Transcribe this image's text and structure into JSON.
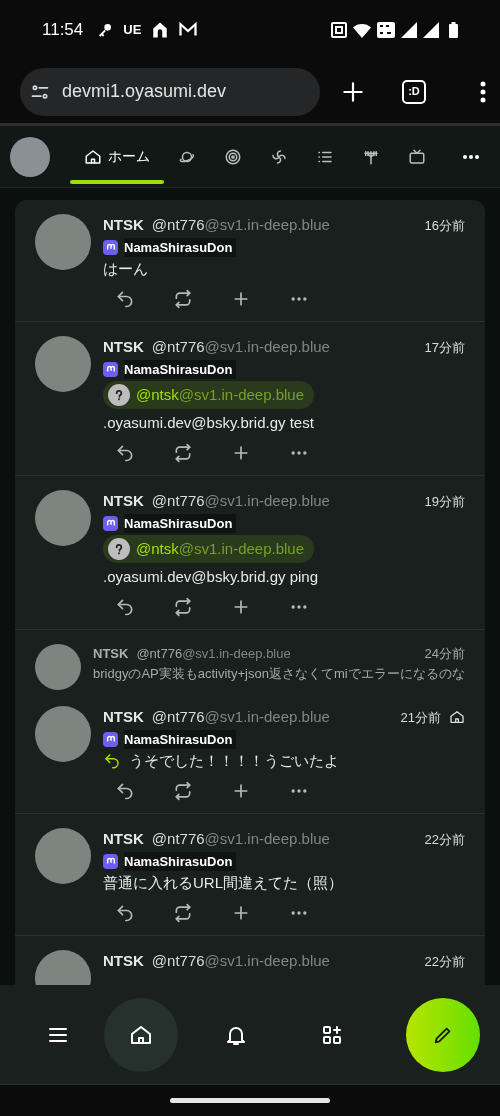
{
  "status_bar": {
    "time": "11:54",
    "carrier_mark": "UE"
  },
  "browser": {
    "url": "devmi1.oyasumi.dev",
    "tab_button": ":D"
  },
  "tabs": [
    {
      "kind": "home",
      "label": "ホーム",
      "selected": true
    },
    {
      "kind": "planet",
      "selected": false
    },
    {
      "kind": "spiral",
      "selected": false
    },
    {
      "kind": "swirl",
      "selected": false
    },
    {
      "kind": "list",
      "selected": false
    },
    {
      "kind": "antenna",
      "selected": false
    },
    {
      "kind": "tv",
      "selected": false
    }
  ],
  "posts": [
    {
      "kind": "note",
      "name": "NTSK",
      "user": "@nt776",
      "host": "@sv1.in-deep.blue",
      "time": "16分前",
      "instance": "NamaShirasuDon",
      "text": "はーん",
      "is_reply": false,
      "home_only": false
    },
    {
      "kind": "note",
      "name": "NTSK",
      "user": "@nt776",
      "host": "@sv1.in-deep.blue",
      "time": "17分前",
      "instance": "NamaShirasuDon",
      "mention": {
        "user": "@ntsk",
        "host": "@sv1.in-deep.blue"
      },
      "text": ".oyasumi.dev@bsky.brid.gy test",
      "is_reply": false,
      "home_only": false
    },
    {
      "kind": "note",
      "name": "NTSK",
      "user": "@nt776",
      "host": "@sv1.in-deep.blue",
      "time": "19分前",
      "instance": "NamaShirasuDon",
      "mention": {
        "user": "@ntsk",
        "host": "@sv1.in-deep.blue"
      },
      "text": ".oyasumi.dev@bsky.brid.gy ping",
      "is_reply": false,
      "home_only": false
    },
    {
      "kind": "parent",
      "name": "NTSK",
      "user": "@nt776",
      "host": "@sv1.in-deep.blue",
      "time": "24分前",
      "text": "bridgyのAP実装もactivity+json返さなくてmiでエラーになるのな"
    },
    {
      "kind": "note",
      "name": "NTSK",
      "user": "@nt776",
      "host": "@sv1.in-deep.blue",
      "time": "21分前",
      "instance": "NamaShirasuDon",
      "text": "うそでした！！！！うごいたよ",
      "is_reply": true,
      "home_only": true
    },
    {
      "kind": "note",
      "name": "NTSK",
      "user": "@nt776",
      "host": "@sv1.in-deep.blue",
      "time": "22分前",
      "instance": "NamaShirasuDon",
      "text": "普通に入れるURL間違えてた（照）",
      "is_reply": false,
      "home_only": false
    },
    {
      "kind": "cut",
      "name": "NTSK",
      "user": "@nt776",
      "host": "@sv1.in-deep.blue",
      "time": "22分前"
    }
  ],
  "bottom_nav": [
    {
      "kind": "menu",
      "selected": false
    },
    {
      "kind": "home",
      "selected": true
    },
    {
      "kind": "bell",
      "selected": false
    },
    {
      "kind": "widgets",
      "selected": false
    }
  ]
}
